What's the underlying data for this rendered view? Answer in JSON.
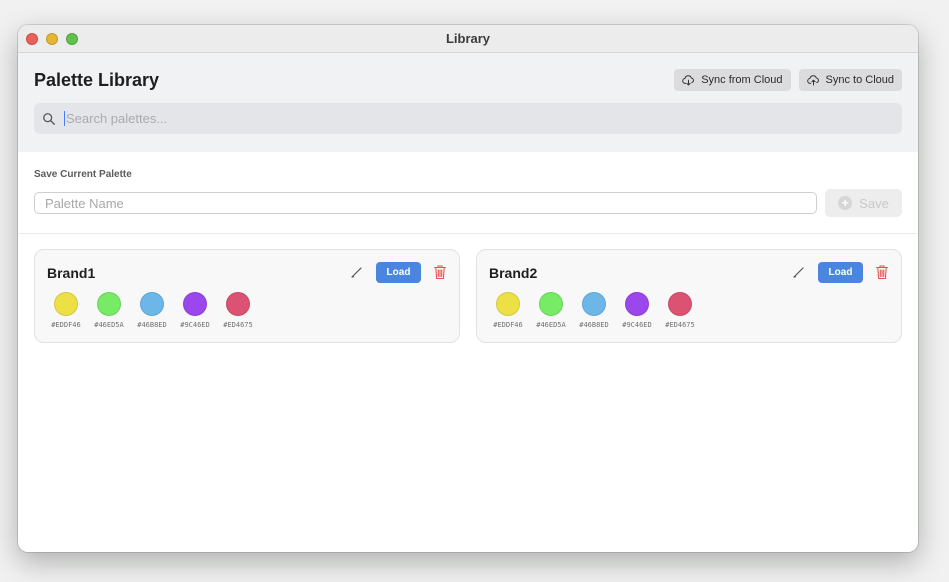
{
  "window": {
    "title": "Library"
  },
  "header": {
    "title": "Palette Library",
    "sync_from_label": "Sync from Cloud",
    "sync_to_label": "Sync to Cloud",
    "search_placeholder": "Search palettes..."
  },
  "save": {
    "section_label": "Save Current Palette",
    "name_placeholder": "Palette Name",
    "save_label": "Save"
  },
  "palettes": [
    {
      "name": "Brand1",
      "load_label": "Load",
      "colors": [
        {
          "hex": "#EDDF46",
          "color": "#EDDF46"
        },
        {
          "hex": "#46ED5A",
          "color": "#77EB65"
        },
        {
          "hex": "#46B8ED",
          "color": "#6CB7E8"
        },
        {
          "hex": "#9C46ED",
          "color": "#9C46ED"
        },
        {
          "hex": "#ED4675",
          "color": "#DC5272"
        }
      ]
    },
    {
      "name": "Brand2",
      "load_label": "Load",
      "colors": [
        {
          "hex": "#EDDF46",
          "color": "#EDDF46"
        },
        {
          "hex": "#46ED5A",
          "color": "#77EB65"
        },
        {
          "hex": "#46B8ED",
          "color": "#6CB7E8"
        },
        {
          "hex": "#9C46ED",
          "color": "#9C46ED"
        },
        {
          "hex": "#ED4675",
          "color": "#DC5272"
        }
      ]
    }
  ],
  "icons": {
    "cloud_download": "cloud-download-icon",
    "cloud_upload": "cloud-upload-icon",
    "search": "search-icon",
    "edit": "pencil-icon",
    "delete": "trash-icon",
    "add": "plus-circle-icon"
  },
  "colors": {
    "accent": "#4A86DE",
    "danger": "#E4554E"
  }
}
